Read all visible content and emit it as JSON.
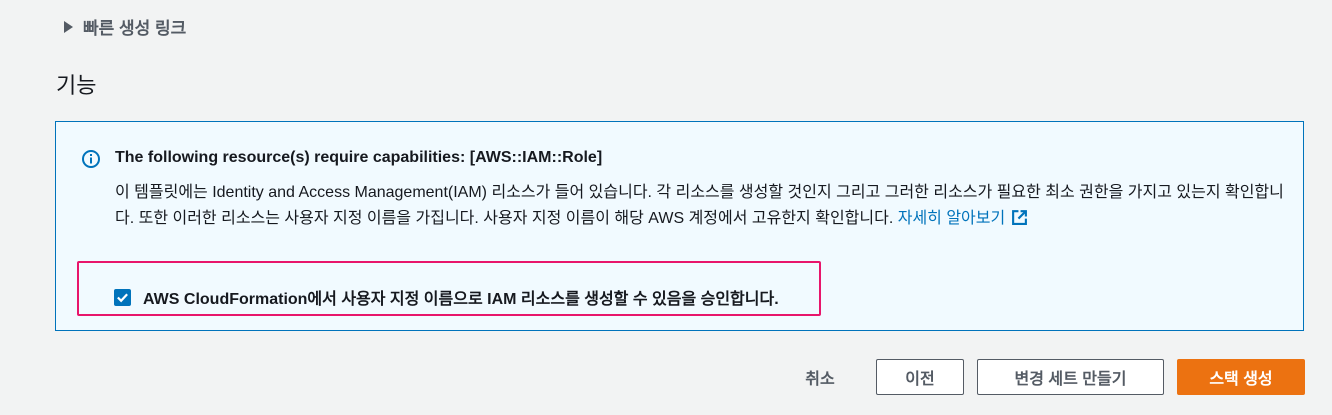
{
  "quick_create_link": {
    "label": "빠른 생성 링크"
  },
  "capabilities": {
    "section_title": "기능",
    "info": {
      "title": "The following resource(s) require capabilities: [AWS::IAM::Role]",
      "body": "이 템플릿에는 Identity and Access Management(IAM) 리소스가 들어 있습니다. 각 리소스를 생성할 것인지 그리고 그러한 리소스가 필요한 최소 권한을 가지고 있는지 확인합니다. 또한 이러한 리소스는 사용자 지정 이름을 가집니다. 사용자 지정 이름이 해당 AWS 계정에서 고유한지 확인합니다. ",
      "learn_more": "자세히 알아보기"
    },
    "acknowledge": {
      "label": "AWS CloudFormation에서 사용자 지정 이름으로 IAM 리소스를 생성할 수 있음을 승인합니다.",
      "checked": true
    }
  },
  "footer": {
    "cancel": "취소",
    "previous": "이전",
    "create_change_set": "변경 세트 만들기",
    "create_stack": "스택 생성"
  },
  "colors": {
    "accent": "#0073bb",
    "primary_button": "#ec7211",
    "highlight": "#e8156b",
    "info_background": "#f1faff"
  },
  "icons": {
    "expand": "caret-right-icon",
    "info": "info-circle-icon",
    "external": "external-link-icon",
    "check": "checkmark-icon"
  }
}
